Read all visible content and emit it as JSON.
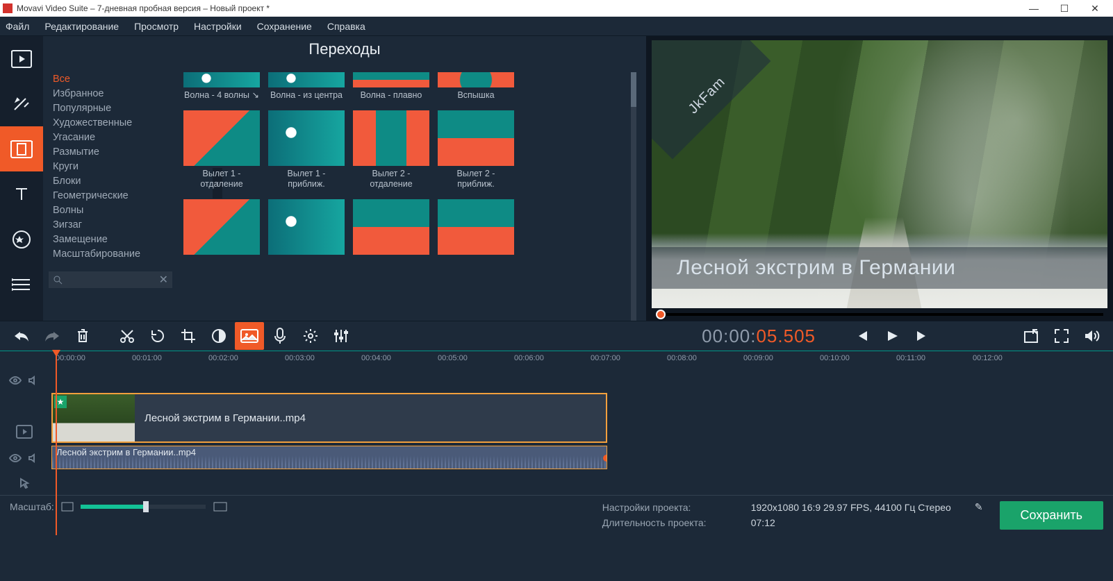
{
  "window": {
    "title": "Movavi Video Suite – 7-дневная пробная версия – Новый проект *",
    "min": "—",
    "max": "☐",
    "close": "✕"
  },
  "menu": [
    "Файл",
    "Редактирование",
    "Просмотр",
    "Настройки",
    "Сохранение",
    "Справка"
  ],
  "panel": {
    "title": "Переходы",
    "categories": [
      "Все",
      "Избранное",
      "Популярные",
      "Художественные",
      "Угасание",
      "Размытие",
      "Круги",
      "Блоки",
      "Геометрические",
      "Волны",
      "Зигзаг",
      "Замещение",
      "Масштабирование"
    ],
    "selected_index": 0,
    "search_clear": "✕"
  },
  "transitions": {
    "row0": [
      "Волна - 4 волны ↘",
      "Волна - из центра",
      "Волна - плавно",
      "Вспышка"
    ],
    "row1": [
      "Вылет 1 - отдаление",
      "Вылет 1 - приближ.",
      "Вылет 2 - отдаление",
      "Вылет 2 - приближ."
    ],
    "row2": [
      "",
      "",
      "",
      ""
    ]
  },
  "preview": {
    "watermark_corner": "JkFam",
    "watermark_text": "Лесной экстрим в Германии"
  },
  "timecode": {
    "inactive": "00:00:",
    "active": "05.505"
  },
  "ruler": [
    "00:00:00",
    "00:01:00",
    "00:02:00",
    "00:03:00",
    "00:04:00",
    "00:05:00",
    "00:06:00",
    "00:07:00",
    "00:08:00",
    "00:09:00",
    "00:10:00",
    "00:11:00",
    "00:12:00"
  ],
  "clips": {
    "video_name": "Лесной экстрим в Германии..mp4",
    "audio_name": "Лесной экстрим в Германии..mp4"
  },
  "bottom": {
    "zoom_label": "Масштаб:",
    "project_label": "Настройки проекта:",
    "project_value": "1920x1080 16:9 29.97 FPS, 44100 Гц Стерео",
    "duration_label": "Длительность проекта:",
    "duration_value": "07:12",
    "save": "Сохранить"
  }
}
